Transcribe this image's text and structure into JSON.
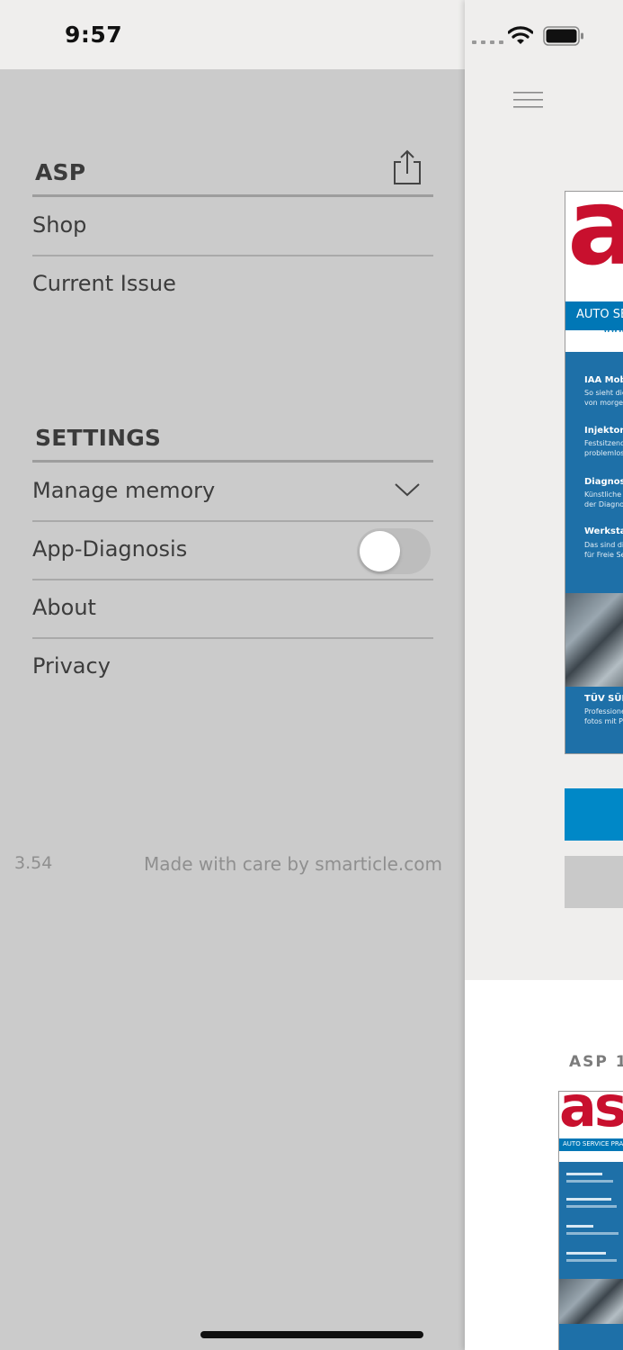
{
  "status_bar": {
    "time": "9:57",
    "icons": [
      "cellular-signal-icon",
      "wifi-icon",
      "battery-icon"
    ]
  },
  "menu": {
    "section_asp": {
      "title": "ASP",
      "share_icon": "share-icon",
      "items": [
        {
          "label": "Shop"
        },
        {
          "label": "Current Issue"
        }
      ]
    },
    "section_settings": {
      "title": "SETTINGS",
      "items": [
        {
          "label": "Manage memory",
          "control": "chevron-down-icon"
        },
        {
          "label": "App-Diagnosis",
          "control": "toggle",
          "toggle_on": false
        },
        {
          "label": "About"
        },
        {
          "label": "Privacy"
        }
      ]
    },
    "footer": {
      "version": "3.54",
      "credit": "Made with care by smarticle.com"
    }
  },
  "content_peek": {
    "hamburger_icon": "hamburger-menu-icon",
    "cover": {
      "logo": "as",
      "bar_text": "AUTO SE",
      "url_text": "www",
      "headlines": [
        {
          "title": "IAA Mob",
          "sub1": "So sieht die",
          "sub2": "von morgen"
        },
        {
          "title": "Injektor",
          "sub1": "Festsitzende",
          "sub2": "problemlos"
        },
        {
          "title": "Diagnos",
          "sub1": "Künstliche I",
          "sub2": "der Diagnos"
        },
        {
          "title": "Werksta",
          "sub1": "Das sind die",
          "sub2": "für Freie Se"
        }
      ],
      "bottom_title": "TÜV SÜD",
      "bottom_sub1": "Professione",
      "bottom_sub2": "fotos mit Ph"
    },
    "issue_label": "ASP 1",
    "thumb": {
      "logo": "as",
      "bar_text": "AUTO SERVICE PRAXIS"
    }
  },
  "colors": {
    "menu_background": "#cbcbcb",
    "status_background": "#efeeed",
    "brand_red": "#c8102e",
    "brand_blue": "#1e70a8",
    "button_blue": "#0088c7"
  }
}
